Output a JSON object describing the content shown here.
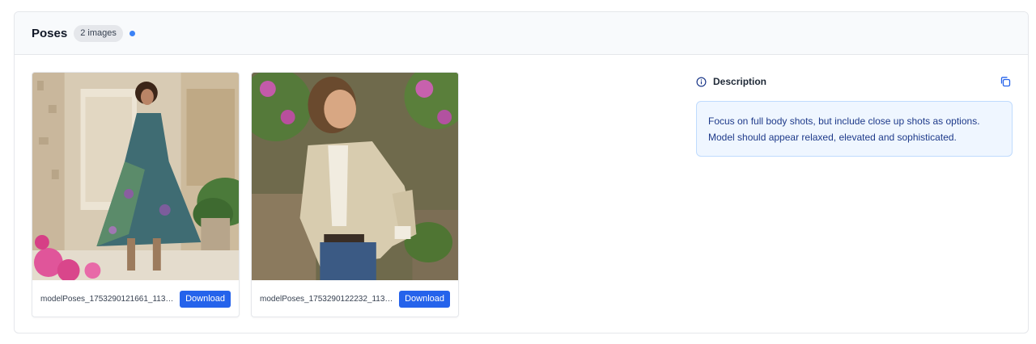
{
  "section": {
    "title": "Poses",
    "count_badge": "2 images",
    "status_dot_color": "#3b82f6"
  },
  "images": [
    {
      "filename": "modelPoses_1753290121661_1139...",
      "download_label": "Download",
      "image_subject": "model in floral maxi dress and boots"
    },
    {
      "filename": "modelPoses_1753290122232_1137...",
      "download_label": "Download",
      "image_subject": "model in beige lace jacket and jeans"
    }
  ],
  "description": {
    "title": "Description",
    "text": "Focus on full body shots, but include close up shots as options. Model should appear relaxed, elevated and sophisticated.",
    "info_icon": "info-icon",
    "copy_icon": "copy-icon"
  },
  "colors": {
    "accent": "#2563eb",
    "desc_bg": "#eff6ff",
    "desc_border": "#bfdbfe",
    "desc_text": "#1e3a8a"
  }
}
